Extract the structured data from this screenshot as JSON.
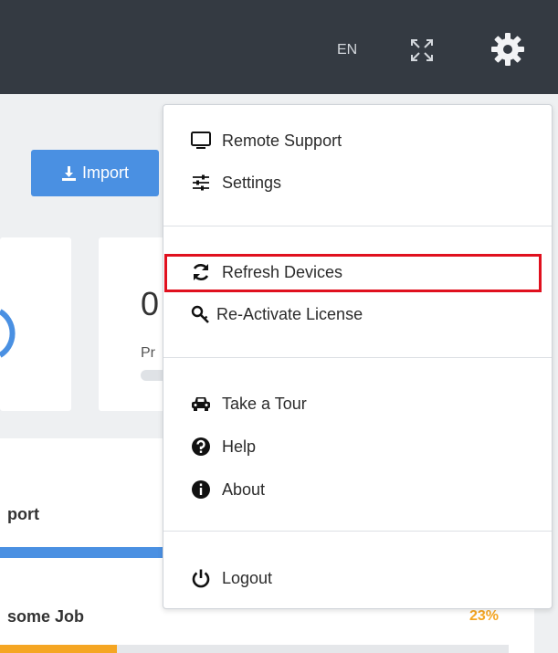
{
  "header": {
    "language": "EN",
    "icons": {
      "expand": "expand-icon",
      "settings": "gear-icon"
    }
  },
  "toolbar": {
    "import_label": "Import"
  },
  "stats": {
    "value": "0",
    "label": "Pr"
  },
  "panel": {
    "title": "port",
    "job_title": "some Job",
    "job_percent": "23%",
    "job_progress": 0.23
  },
  "menu": {
    "groups": [
      [
        {
          "label": "Remote Support",
          "icon": "monitor-icon"
        },
        {
          "label": "Settings",
          "icon": "sliders-icon"
        }
      ],
      [
        {
          "label": "Refresh Devices",
          "icon": "refresh-icon",
          "highlighted": true
        },
        {
          "label": "Re-Activate License",
          "icon": "key-icon"
        }
      ],
      [
        {
          "label": "Take a Tour",
          "icon": "car-icon"
        },
        {
          "label": "Help",
          "icon": "question-circle-icon"
        },
        {
          "label": "About",
          "icon": "info-circle-icon"
        }
      ],
      [
        {
          "label": "Logout",
          "icon": "power-icon"
        }
      ]
    ]
  },
  "colors": {
    "topbar": "#343a42",
    "accent": "#4a90e2",
    "highlight_border": "#e0101e",
    "job_color": "#f5a623"
  }
}
